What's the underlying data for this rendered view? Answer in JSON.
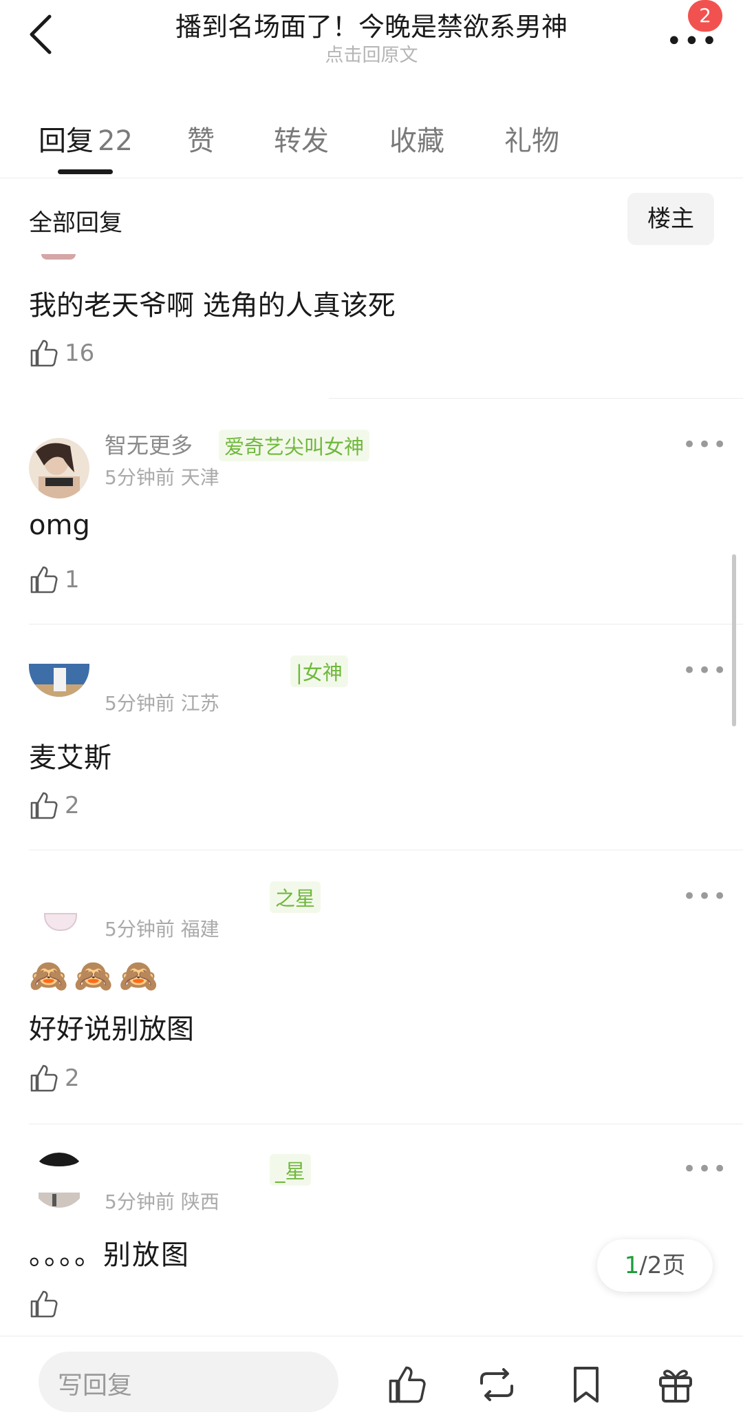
{
  "header": {
    "title": "播到名场面了！今晚是禁欲系男神",
    "subtitle": "点击回原文",
    "badge_count": "2"
  },
  "tabs": [
    {
      "label": "回复",
      "count": "22",
      "active": true
    },
    {
      "label": "赞"
    },
    {
      "label": "转发"
    },
    {
      "label": "收藏"
    },
    {
      "label": "礼物"
    }
  ],
  "section": {
    "title": "全部回复",
    "filter_label": "楼主"
  },
  "comments": [
    {
      "text": "我的老天爷啊 选角的人真该死",
      "likes": "16"
    },
    {
      "username": "智无更多",
      "tag": "爱奇艺尖叫女神",
      "meta": "5分钟前 天津",
      "text": "omg",
      "likes": "1"
    },
    {
      "tag": "|女神",
      "meta": "5分钟前 江苏",
      "text": "麦艾斯",
      "likes": "2"
    },
    {
      "tag": "之星",
      "meta": "5分钟前 福建",
      "emoji": "🙈🙈🙈",
      "text": "好好说别放图",
      "likes": "2"
    },
    {
      "tag": "_星",
      "meta": "5分钟前 陕西",
      "text": "。。。。别放图",
      "likes": ""
    }
  ],
  "pager": {
    "current": "1",
    "total_suffix": "/2页"
  },
  "bottom": {
    "reply_placeholder": "写回复"
  },
  "icons": {
    "back": "chevron-left-icon",
    "more": "more-dots-icon",
    "like": "thumbs-up-icon",
    "repost": "repost-icon",
    "bookmark": "bookmark-icon",
    "gift": "gift-icon"
  },
  "colors": {
    "badge": "#f2524f",
    "tag_green": "#6fb83c",
    "page_current": "#1e9b3c"
  }
}
